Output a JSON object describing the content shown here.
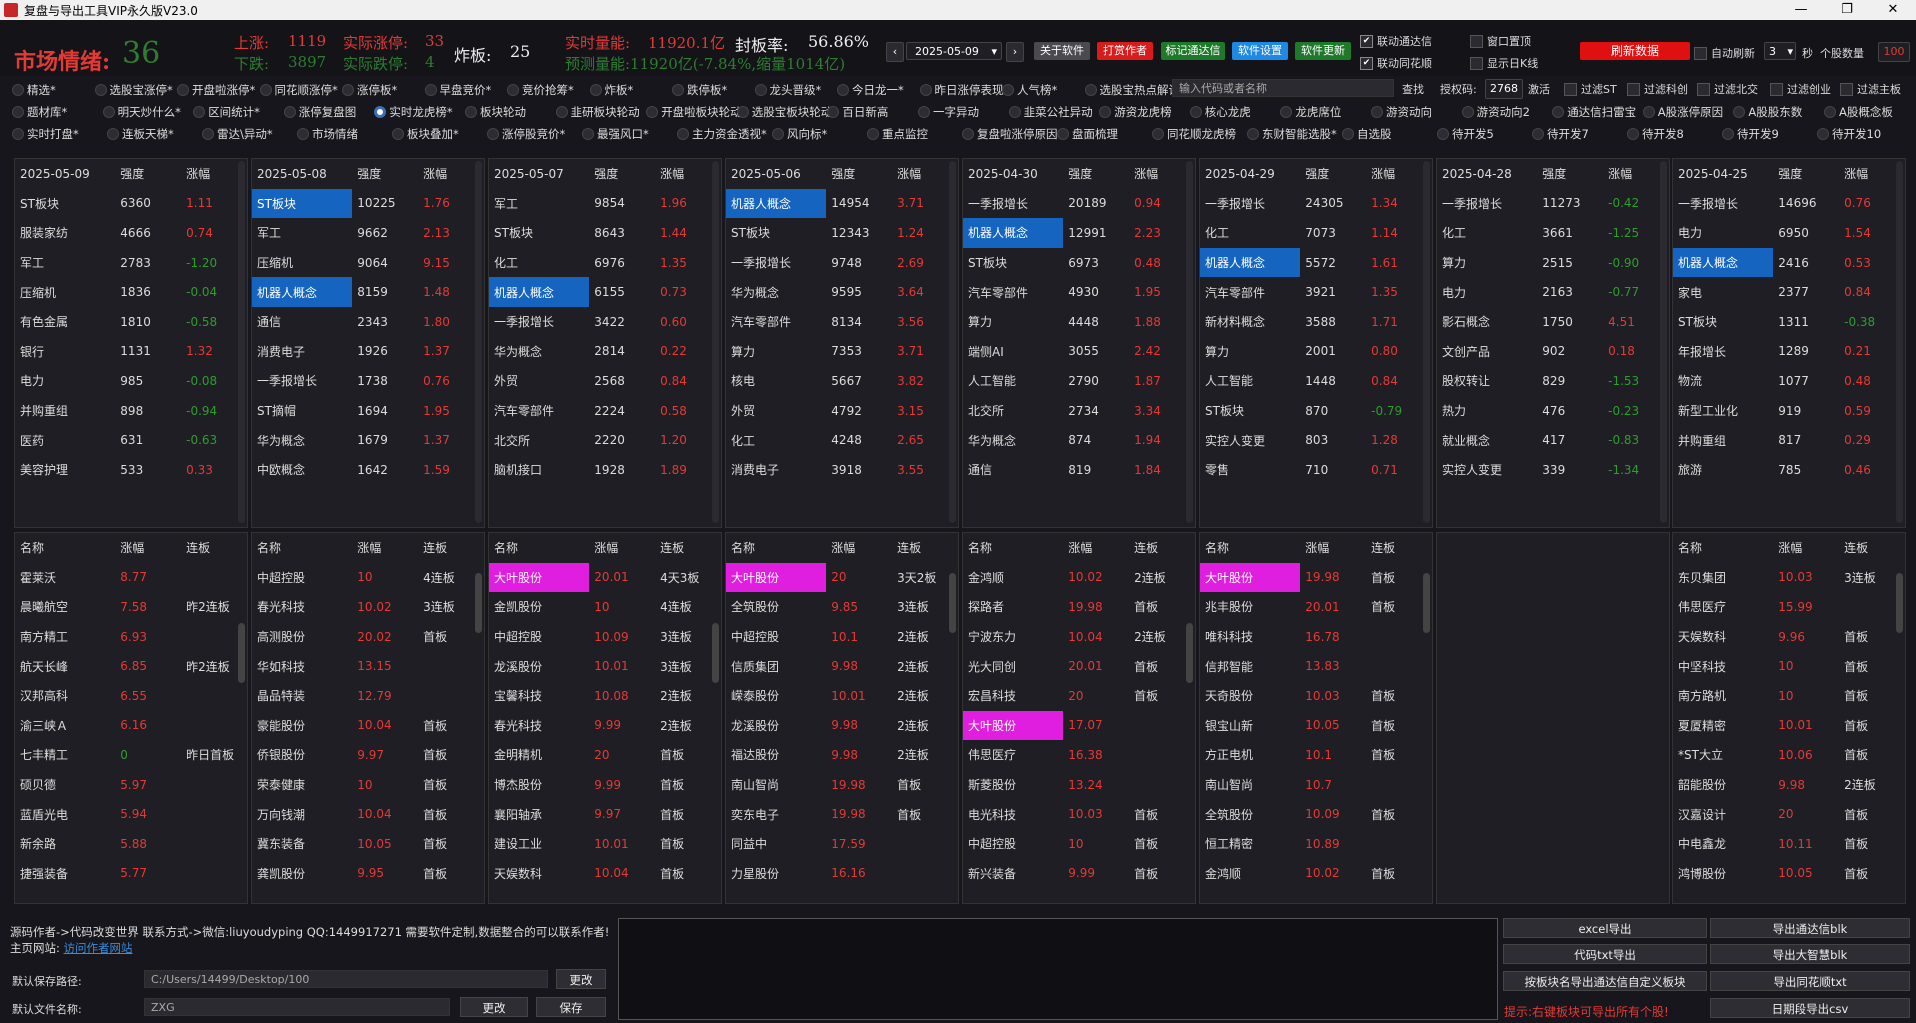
{
  "window": {
    "title": "复盘与导出工具VIP永久版V23.0",
    "min": "—",
    "max": "❐",
    "close": "✕"
  },
  "header": {
    "mood_label": "市场情绪:",
    "mood_value": "36",
    "up_label": "上涨:",
    "up_value": "1119",
    "real_up_label": "实际涨停:",
    "real_up_value": "33",
    "down_label": "下跌:",
    "down_value": "3897",
    "real_down_label": "实际跌停:",
    "real_down_value": "4",
    "burst_label": "炸板:",
    "burst_value": "25",
    "volume_label": "实时量能:",
    "volume_value": "11920.1亿",
    "seal_label": "封板率:",
    "seal_value": "56.86%",
    "predict": "预测量能:11920亿(-7.84%,缩量1014亿)",
    "date": "2025-05-09",
    "btn_about": "关于软件",
    "btn_reward": "打赏作者",
    "btn_tdx": "标记通达信",
    "btn_settings": "软件设置",
    "btn_update": "软件更新",
    "chk_link_tdx": "联动通达信",
    "chk_link_ths": "联动同花顺",
    "chk_top": "窗口置顶",
    "chk_daily": "显示日K线",
    "refresh": "刷新数据",
    "chk_auto": "自动刷新",
    "auto_seconds": "3",
    "sec_label": "秒",
    "count_label": "个股数量",
    "count_value": "100"
  },
  "tabs_row1": [
    "精选*",
    "选股宝涨停*",
    "开盘啦涨停*",
    "同花顺涨停*",
    "涨停板*",
    "早盘竞价*",
    "竞价抢筹*",
    "炸板*",
    "跌停板*",
    "龙头晋级*",
    "今日龙一*",
    "昨日涨停表现*",
    "人气榜*",
    "选股宝热点解读*"
  ],
  "search": {
    "placeholder": "输入代码或者名称",
    "btn": "查找",
    "auth_label": "授权码:",
    "auth_value": "2768",
    "activate": "激活",
    "f1": "过滤ST",
    "f2": "过滤科创",
    "f3": "过滤北交",
    "f4": "过滤创业",
    "f5": "过滤主板"
  },
  "tabs_row2": [
    "题材库*",
    "明天炒什么*",
    "区间统计*",
    "涨停复盘图",
    "实时龙虎榜*",
    "板块轮动",
    "韭研板块轮动",
    "开盘啦板块轮动",
    "选股宝板块轮动*",
    "百日新高",
    "一字异动",
    "韭菜公社异动",
    "游资龙虎榜",
    "核心龙虎",
    "龙虎席位",
    "游资动向",
    "游资动向2",
    "通达信扫雷宝",
    "A股涨停原因",
    "A股股东数",
    "A股概念板"
  ],
  "tabs_row3": [
    "实时打盘*",
    "连板天梯*",
    "雷达\\异动*",
    "市场情绪",
    "板块叠加*",
    "涨停股竞价*",
    "最强风口*",
    "主力资金透视*",
    "风向标*",
    "重点监控",
    "复盘啦涨停原因",
    "盘面梳理",
    "同花顺龙虎榜",
    "东财智能选股*",
    "自选股",
    "待开发5",
    "待开发7",
    "待开发8",
    "待开发9",
    "待开发10"
  ],
  "sectors": [
    {
      "date": "2025-05-09",
      "h2": "强度",
      "h3": "涨幅",
      "rows": [
        [
          "ST板块",
          "6360",
          "1.11",
          "r"
        ],
        [
          "服装家纺",
          "4666",
          "0.74",
          "r"
        ],
        [
          "军工",
          "2783",
          "-1.20",
          "g"
        ],
        [
          "压缩机",
          "1836",
          "-0.04",
          "g"
        ],
        [
          "有色金属",
          "1810",
          "-0.58",
          "g"
        ],
        [
          "银行",
          "1131",
          "1.32",
          "r"
        ],
        [
          "电力",
          "985",
          "-0.08",
          "g"
        ],
        [
          "并购重组",
          "898",
          "-0.94",
          "g"
        ],
        [
          "医药",
          "631",
          "-0.63",
          "g"
        ],
        [
          "美容护理",
          "533",
          "0.33",
          "r"
        ]
      ]
    },
    {
      "date": "2025-05-08",
      "h2": "强度",
      "h3": "涨幅",
      "rows": [
        [
          "ST板块",
          "10225",
          "1.76",
          "r",
          "b"
        ],
        [
          "军工",
          "9662",
          "2.13",
          "r"
        ],
        [
          "压缩机",
          "9064",
          "9.15",
          "r"
        ],
        [
          "机器人概念",
          "8159",
          "1.48",
          "r",
          "b"
        ],
        [
          "通信",
          "2343",
          "1.80",
          "r"
        ],
        [
          "消费电子",
          "1926",
          "1.37",
          "r"
        ],
        [
          "一季报增长",
          "1738",
          "0.76",
          "r"
        ],
        [
          "ST摘帽",
          "1694",
          "1.95",
          "r"
        ],
        [
          "华为概念",
          "1679",
          "1.37",
          "r"
        ],
        [
          "中欧概念",
          "1642",
          "1.59",
          "r"
        ]
      ]
    },
    {
      "date": "2025-05-07",
      "h2": "强度",
      "h3": "涨幅",
      "rows": [
        [
          "军工",
          "9854",
          "1.96",
          "r"
        ],
        [
          "ST板块",
          "8643",
          "1.44",
          "r"
        ],
        [
          "化工",
          "6976",
          "1.35",
          "r"
        ],
        [
          "机器人概念",
          "6155",
          "0.73",
          "r",
          "b"
        ],
        [
          "一季报增长",
          "3422",
          "0.60",
          "r"
        ],
        [
          "华为概念",
          "2814",
          "0.22",
          "r"
        ],
        [
          "外贸",
          "2568",
          "0.84",
          "r"
        ],
        [
          "汽车零部件",
          "2224",
          "0.58",
          "r"
        ],
        [
          "北交所",
          "2220",
          "1.20",
          "r"
        ],
        [
          "脑机接口",
          "1928",
          "1.89",
          "r"
        ]
      ]
    },
    {
      "date": "2025-05-06",
      "h2": "强度",
      "h3": "涨幅",
      "rows": [
        [
          "机器人概念",
          "14954",
          "3.71",
          "r",
          "b"
        ],
        [
          "ST板块",
          "12343",
          "1.24",
          "r"
        ],
        [
          "一季报增长",
          "9748",
          "2.69",
          "r"
        ],
        [
          "华为概念",
          "9595",
          "3.64",
          "r"
        ],
        [
          "汽车零部件",
          "8134",
          "3.56",
          "r"
        ],
        [
          "算力",
          "7353",
          "3.71",
          "r"
        ],
        [
          "核电",
          "5667",
          "3.82",
          "r"
        ],
        [
          "外贸",
          "4792",
          "3.15",
          "r"
        ],
        [
          "化工",
          "4248",
          "2.65",
          "r"
        ],
        [
          "消费电子",
          "3918",
          "3.55",
          "r"
        ]
      ]
    },
    {
      "date": "2025-04-30",
      "h2": "强度",
      "h3": "涨幅",
      "rows": [
        [
          "一季报增长",
          "20189",
          "0.94",
          "r"
        ],
        [
          "机器人概念",
          "12991",
          "2.23",
          "r",
          "b"
        ],
        [
          "ST板块",
          "6973",
          "0.48",
          "r"
        ],
        [
          "汽车零部件",
          "4930",
          "1.95",
          "r"
        ],
        [
          "算力",
          "4448",
          "1.88",
          "r"
        ],
        [
          "端侧AI",
          "3055",
          "2.42",
          "r"
        ],
        [
          "人工智能",
          "2790",
          "1.87",
          "r"
        ],
        [
          "北交所",
          "2734",
          "3.34",
          "r"
        ],
        [
          "华为概念",
          "874",
          "1.94",
          "r"
        ],
        [
          "通信",
          "819",
          "1.84",
          "r"
        ]
      ]
    },
    {
      "date": "2025-04-29",
      "h2": "强度",
      "h3": "涨幅",
      "rows": [
        [
          "一季报增长",
          "24305",
          "1.34",
          "r"
        ],
        [
          "化工",
          "7073",
          "1.14",
          "r"
        ],
        [
          "机器人概念",
          "5572",
          "1.61",
          "r",
          "b"
        ],
        [
          "汽车零部件",
          "3921",
          "1.35",
          "r"
        ],
        [
          "新材料概念",
          "3588",
          "1.71",
          "r"
        ],
        [
          "算力",
          "2001",
          "0.80",
          "r"
        ],
        [
          "人工智能",
          "1448",
          "0.84",
          "r"
        ],
        [
          "ST板块",
          "870",
          "-0.79",
          "g"
        ],
        [
          "实控人变更",
          "803",
          "1.28",
          "r"
        ],
        [
          "零售",
          "710",
          "0.71",
          "r"
        ]
      ]
    },
    {
      "date": "2025-04-28",
      "h2": "强度",
      "h3": "涨幅",
      "rows": [
        [
          "一季报增长",
          "11273",
          "-0.42",
          "g"
        ],
        [
          "化工",
          "3661",
          "-1.25",
          "g"
        ],
        [
          "算力",
          "2515",
          "-0.90",
          "g"
        ],
        [
          "电力",
          "2163",
          "-0.77",
          "g"
        ],
        [
          "影石概念",
          "1750",
          "4.51",
          "r"
        ],
        [
          "文创产品",
          "902",
          "0.18",
          "r"
        ],
        [
          "股权转让",
          "829",
          "-1.53",
          "g"
        ],
        [
          "热力",
          "476",
          "-0.23",
          "g"
        ],
        [
          "就业概念",
          "417",
          "-0.83",
          "g"
        ],
        [
          "实控人变更",
          "339",
          "-1.34",
          "g"
        ]
      ]
    },
    {
      "date": "2025-04-25",
      "h2": "强度",
      "h3": "涨幅",
      "rows": [
        [
          "一季报增长",
          "14696",
          "0.76",
          "r"
        ],
        [
          "电力",
          "6950",
          "1.54",
          "r"
        ],
        [
          "机器人概念",
          "2416",
          "0.53",
          "r",
          "b"
        ],
        [
          "家电",
          "2377",
          "0.84",
          "r"
        ],
        [
          "ST板块",
          "1311",
          "-0.38",
          "g"
        ],
        [
          "年报增长",
          "1289",
          "0.21",
          "r"
        ],
        [
          "物流",
          "1077",
          "0.48",
          "r"
        ],
        [
          "新型工业化",
          "919",
          "0.59",
          "r"
        ],
        [
          "并购重组",
          "817",
          "0.29",
          "r"
        ],
        [
          "旅游",
          "785",
          "0.46",
          "r"
        ]
      ]
    }
  ],
  "stocks": [
    {
      "h1": "名称",
      "h2": "涨幅",
      "h3": "连板",
      "rows": [
        [
          "霍莱沃",
          "8.77",
          "",
          "r"
        ],
        [
          "晨曦航空",
          "7.58",
          "昨2连板",
          "r"
        ],
        [
          "南方精工",
          "6.93",
          "",
          "r"
        ],
        [
          "航天长峰",
          "6.85",
          "昨2连板",
          "r"
        ],
        [
          "汉邦高科",
          "6.55",
          "",
          "r"
        ],
        [
          "渝三峡Ａ",
          "6.16",
          "",
          "r"
        ],
        [
          "七丰精工",
          "0",
          "昨日首板",
          "g"
        ],
        [
          "硕贝德",
          "5.97",
          "",
          "r"
        ],
        [
          "蓝盾光电",
          "5.94",
          "",
          "r"
        ],
        [
          "新余路",
          "5.88",
          "",
          "r"
        ],
        [
          "捷强装备",
          "5.77",
          "",
          "r"
        ]
      ]
    },
    {
      "h1": "名称",
      "h2": "涨幅",
      "h3": "连板",
      "rows": [
        [
          "中超控股",
          "10",
          "4连板",
          "r"
        ],
        [
          "春光科技",
          "10.02",
          "3连板",
          "r"
        ],
        [
          "高测股份",
          "20.02",
          "首板",
          "r"
        ],
        [
          "华如科技",
          "13.15",
          "",
          "r"
        ],
        [
          "晶品特装",
          "12.79",
          "",
          "r"
        ],
        [
          "豪能股份",
          "10.04",
          "首板",
          "r"
        ],
        [
          "侨银股份",
          "9.97",
          "首板",
          "r"
        ],
        [
          "荣泰健康",
          "10",
          "首板",
          "r"
        ],
        [
          "万向钱潮",
          "10.04",
          "首板",
          "r"
        ],
        [
          "冀东装备",
          "10.05",
          "首板",
          "r"
        ],
        [
          "龚凯股份",
          "9.95",
          "首板",
          "r"
        ]
      ]
    },
    {
      "h1": "名称",
      "h2": "涨幅",
      "h3": "连板",
      "rows": [
        [
          "大叶股份",
          "20.01",
          "4天3板",
          "r",
          "m"
        ],
        [
          "金凯股份",
          "10",
          "4连板",
          "r"
        ],
        [
          "中超控股",
          "10.09",
          "3连板",
          "r"
        ],
        [
          "龙溪股份",
          "10.01",
          "3连板",
          "r"
        ],
        [
          "宝馨科技",
          "10.08",
          "2连板",
          "r"
        ],
        [
          "春光科技",
          "9.99",
          "2连板",
          "r"
        ],
        [
          "金明精机",
          "20",
          "首板",
          "r"
        ],
        [
          "博杰股份",
          "9.99",
          "首板",
          "r"
        ],
        [
          "襄阳轴承",
          "9.97",
          "首板",
          "r"
        ],
        [
          "建设工业",
          "10.01",
          "首板",
          "r"
        ],
        [
          "天娱数科",
          "10.04",
          "首板",
          "r"
        ]
      ]
    },
    {
      "h1": "名称",
      "h2": "涨幅",
      "h3": "连板",
      "rows": [
        [
          "大叶股份",
          "20",
          "3天2板",
          "r",
          "m"
        ],
        [
          "全筑股份",
          "9.85",
          "3连板",
          "r"
        ],
        [
          "中超控股",
          "10.1",
          "2连板",
          "r"
        ],
        [
          "信质集团",
          "9.98",
          "2连板",
          "r"
        ],
        [
          "嵘泰股份",
          "10.01",
          "2连板",
          "r"
        ],
        [
          "龙溪股份",
          "9.98",
          "2连板",
          "r"
        ],
        [
          "福达股份",
          "9.98",
          "2连板",
          "r"
        ],
        [
          "南山智尚",
          "19.98",
          "首板",
          "r"
        ],
        [
          "奕东电子",
          "19.98",
          "首板",
          "r"
        ],
        [
          "同益中",
          "17.59",
          "",
          "r"
        ],
        [
          "力星股份",
          "16.16",
          "",
          "r"
        ]
      ]
    },
    {
      "h1": "名称",
      "h2": "涨幅",
      "h3": "连板",
      "rows": [
        [
          "金鸿顺",
          "10.02",
          "2连板",
          "r"
        ],
        [
          "探路者",
          "19.98",
          "首板",
          "r"
        ],
        [
          "宁波东力",
          "10.04",
          "2连板",
          "r"
        ],
        [
          "光大同创",
          "20.01",
          "首板",
          "r"
        ],
        [
          "宏昌科技",
          "20",
          "首板",
          "r"
        ],
        [
          "大叶股份",
          "17.07",
          "",
          "r",
          "m"
        ],
        [
          "伟思医疗",
          "16.38",
          "",
          "r"
        ],
        [
          "斯菱股份",
          "13.24",
          "",
          "r"
        ],
        [
          "电光科技",
          "10.03",
          "首板",
          "r"
        ],
        [
          "中超控股",
          "10",
          "首板",
          "r"
        ],
        [
          "新兴装备",
          "9.99",
          "首板",
          "r"
        ]
      ]
    },
    {
      "h1": "名称",
      "h2": "涨幅",
      "h3": "连板",
      "rows": [
        [
          "大叶股份",
          "19.98",
          "首板",
          "r",
          "m"
        ],
        [
          "兆丰股份",
          "20.01",
          "首板",
          "r"
        ],
        [
          "唯科科技",
          "16.78",
          "",
          "r"
        ],
        [
          "信邦智能",
          "13.83",
          "",
          "r"
        ],
        [
          "天奇股份",
          "10.03",
          "首板",
          "r"
        ],
        [
          "银宝山新",
          "10.05",
          "首板",
          "r"
        ],
        [
          "方正电机",
          "10.1",
          "首板",
          "r"
        ],
        [
          "南山智尚",
          "10.7",
          "",
          "r"
        ],
        [
          "全筑股份",
          "10.09",
          "首板",
          "r"
        ],
        [
          "恒工精密",
          "10.89",
          "",
          "r"
        ],
        [
          "金鸿顺",
          "10.02",
          "首板",
          "r"
        ]
      ]
    },
    {
      "h1": "",
      "h2": "",
      "h3": "",
      "rows": []
    },
    {
      "h1": "名称",
      "h2": "涨幅",
      "h3": "连板",
      "rows": [
        [
          "东贝集团",
          "10.03",
          "3连板",
          "r"
        ],
        [
          "伟思医疗",
          "15.99",
          "",
          "r"
        ],
        [
          "天娱数科",
          "9.96",
          "首板",
          "r"
        ],
        [
          "中坚科技",
          "10",
          "首板",
          "r"
        ],
        [
          "南方路机",
          "10",
          "首板",
          "r"
        ],
        [
          "夏厦精密",
          "10.01",
          "首板",
          "r"
        ],
        [
          "*ST大立",
          "10.06",
          "首板",
          "r"
        ],
        [
          "韶能股份",
          "9.98",
          "2连板",
          "r"
        ],
        [
          "汉嘉设计",
          "20",
          "首板",
          "r"
        ],
        [
          "中电鑫龙",
          "10.11",
          "首板",
          "r"
        ],
        [
          "鸿博股份",
          "10.05",
          "首板",
          "r"
        ]
      ]
    }
  ],
  "bottom": {
    "info": "源码作者->代码改变世界 联系方式->微信:liuyoudyping QQ:1449917271 需要软件定制,数据整合的可以联系作者! 主页网站:",
    "link": "访问作者网站",
    "path_label": "默认保存路径:",
    "path_value": "C:/Users/14499/Desktop/100",
    "path_btn": "更改",
    "file_label": "默认文件名称:",
    "file_value": "ZXG",
    "file_btn": "更改",
    "save_btn": "保存",
    "b1": "excel导出",
    "b2": "导出通达信blk",
    "b3": "代码txt导出",
    "b4": "导出大智慧blk",
    "b5": "按板块名导出通达信自定义板块",
    "b6": "导出同花顺txt",
    "b7": "日期段导出csv",
    "tip": "提示:右键板块可导出所有个股!"
  }
}
